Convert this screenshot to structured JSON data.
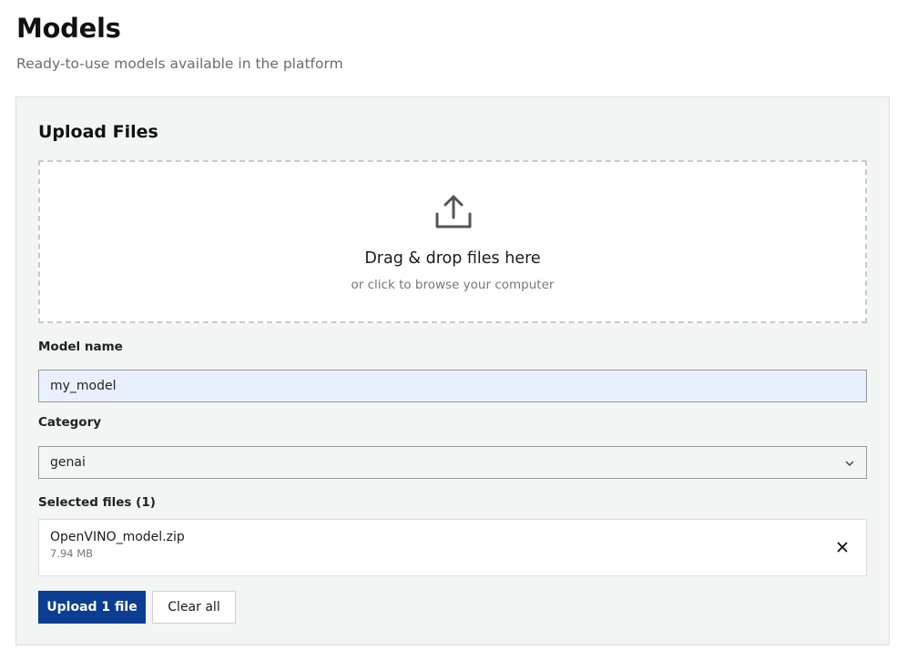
{
  "page": {
    "title": "Models",
    "subtitle": "Ready-to-use models available in the platform"
  },
  "upload": {
    "title": "Upload Files",
    "dropzone": {
      "icon": "upload-icon",
      "title": "Drag & drop files here",
      "hint": "or click to browse your computer"
    },
    "model_name": {
      "label": "Model name",
      "value": "my_model"
    },
    "category": {
      "label": "Category",
      "selected": "genai",
      "icon": "chevron-down-icon"
    },
    "selected_files": {
      "label": "Selected files (1)",
      "files": [
        {
          "name": "OpenVINO_model.zip",
          "size": "7.94 MB",
          "remove_icon": "close-icon"
        }
      ]
    },
    "buttons": {
      "upload": "Upload 1 file",
      "clear": "Clear all"
    }
  },
  "colors": {
    "primary": "#0b3d91",
    "panel_bg": "#f3f4f4",
    "input_autofill_bg": "#e8f0fe"
  }
}
